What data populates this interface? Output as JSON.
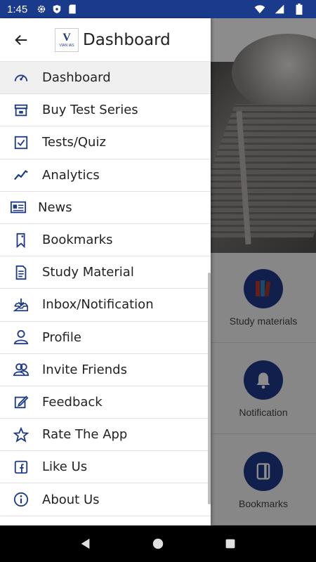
{
  "status_bar": {
    "time": "1:45",
    "left_icons": [
      "gear-icon",
      "shield-icon",
      "sd-card-icon"
    ],
    "right_icons": [
      "wifi-icon",
      "signal-icon",
      "battery-icon"
    ]
  },
  "drawer": {
    "title": "Dashboard",
    "logo": {
      "mark": "V",
      "text": "VIAN IAS"
    },
    "items": [
      {
        "label": "Dashboard",
        "icon": "speedometer-icon"
      },
      {
        "label": "Buy Test Series",
        "icon": "shop-icon"
      },
      {
        "label": "Tests/Quiz",
        "icon": "checklist-icon"
      },
      {
        "label": "Analytics",
        "icon": "analytics-icon"
      },
      {
        "label": "News",
        "icon": "newspaper-icon"
      },
      {
        "label": "Bookmarks",
        "icon": "bookmark-icon"
      },
      {
        "label": "Study Material",
        "icon": "document-icon"
      },
      {
        "label": "Inbox/Notification",
        "icon": "inbox-icon"
      },
      {
        "label": "Profile",
        "icon": "user-icon"
      },
      {
        "label": "Invite Friends",
        "icon": "users-icon"
      },
      {
        "label": "Feedback",
        "icon": "edit-icon"
      },
      {
        "label": "Rate The App",
        "icon": "star-icon"
      },
      {
        "label": "Like Us",
        "icon": "facebook-icon"
      },
      {
        "label": "About Us",
        "icon": "info-icon"
      }
    ]
  },
  "main": {
    "cards": [
      {
        "label": "Study materials",
        "icon": "books-icon"
      },
      {
        "label": "Notification",
        "icon": "bell-icon"
      },
      {
        "label": "Bookmarks",
        "icon": "bookmark-book-icon"
      }
    ]
  },
  "colors": {
    "status_bar": "#1a3b8c",
    "accent": "#1e3a8a",
    "icon": "#1e3a8a"
  },
  "nav_bar": {
    "buttons": [
      "back-triangle-icon",
      "home-circle-icon",
      "recents-square-icon"
    ]
  }
}
